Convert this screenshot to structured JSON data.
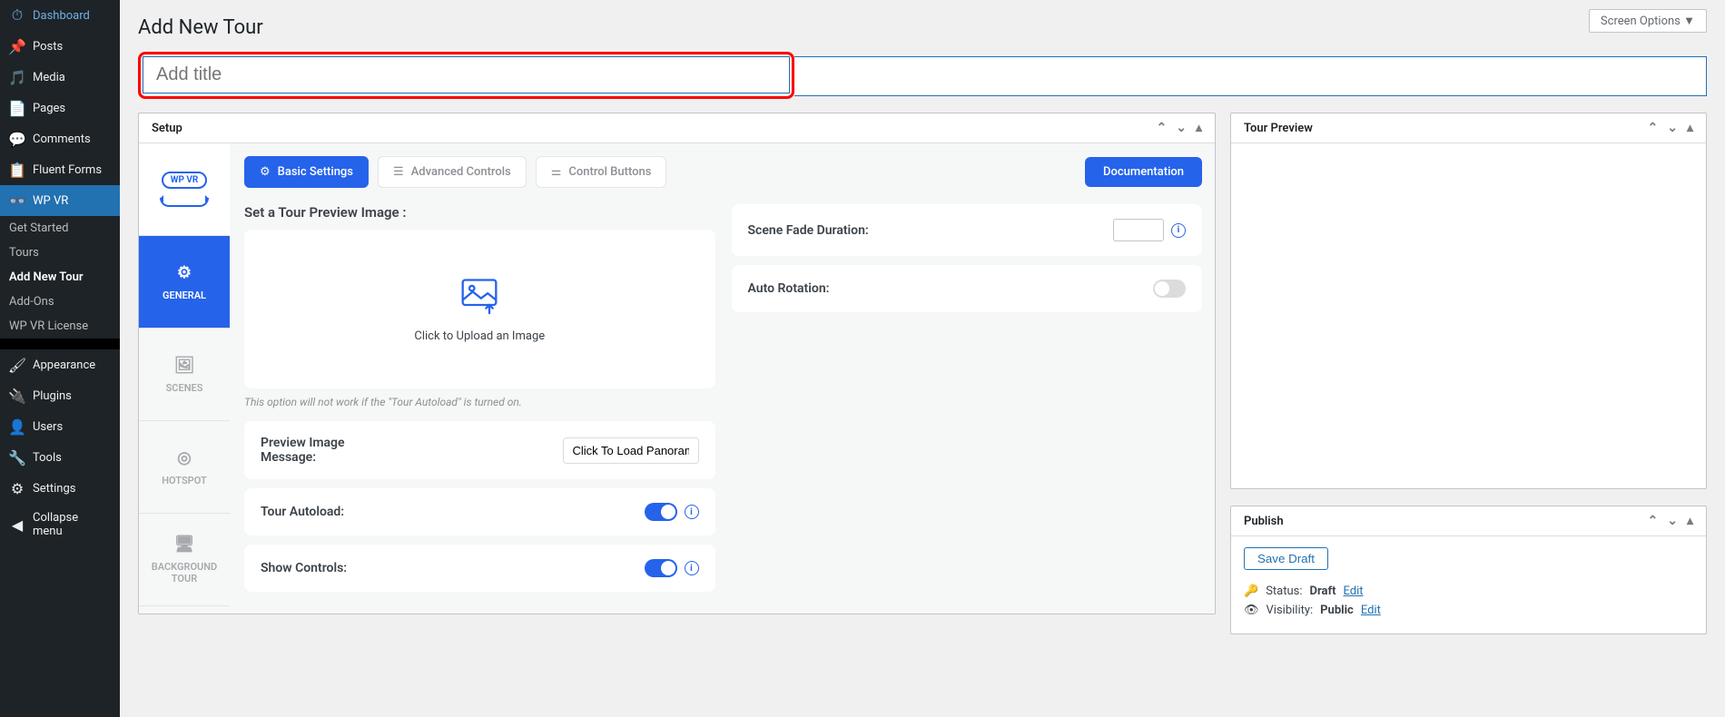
{
  "screen_options": "Screen Options",
  "page_title": "Add New Tour",
  "title_placeholder": "Add title",
  "sidebar": {
    "items": [
      {
        "label": "Dashboard",
        "icon": "dashboard"
      },
      {
        "label": "Posts",
        "icon": "pin"
      },
      {
        "label": "Media",
        "icon": "media"
      },
      {
        "label": "Pages",
        "icon": "pages"
      },
      {
        "label": "Comments",
        "icon": "comment"
      },
      {
        "label": "Fluent Forms",
        "icon": "forms"
      },
      {
        "label": "WP VR",
        "icon": "vr"
      },
      {
        "label": "Appearance",
        "icon": "appearance"
      },
      {
        "label": "Plugins",
        "icon": "plugins"
      },
      {
        "label": "Users",
        "icon": "users"
      },
      {
        "label": "Tools",
        "icon": "tools"
      },
      {
        "label": "Settings",
        "icon": "settings"
      },
      {
        "label": "Collapse menu",
        "icon": "collapse"
      }
    ],
    "sub": [
      {
        "label": "Get Started"
      },
      {
        "label": "Tours"
      },
      {
        "label": "Add New Tour"
      },
      {
        "label": "Add-Ons"
      },
      {
        "label": "WP VR License"
      }
    ]
  },
  "setup": {
    "title": "Setup",
    "logo": "WP VR",
    "tabs": {
      "general": "GENERAL",
      "scenes": "SCENES",
      "hotspot": "HOTSPOT",
      "background": "BACKGROUND TOUR"
    },
    "top_tabs": {
      "basic": "Basic Settings",
      "advanced": "Advanced Controls",
      "control": "Control Buttons"
    },
    "doc_btn": "Documentation",
    "preview_label": "Set a Tour Preview Image :",
    "upload_text": "Click to Upload an Image",
    "hint": "This option will not work if the \"Tour Autoload\" is turned on.",
    "preview_msg_label": "Preview Image Message:",
    "preview_msg_value": "Click To Load Panoram",
    "autoload_label": "Tour Autoload:",
    "show_controls_label": "Show Controls:",
    "fade_label": "Scene Fade Duration:",
    "rotation_label": "Auto Rotation:"
  },
  "tour_preview": {
    "title": "Tour Preview"
  },
  "publish": {
    "title": "Publish",
    "save_draft": "Save Draft",
    "status_label": "Status:",
    "status_value": "Draft",
    "status_edit": "Edit",
    "visibility_label": "Visibility:",
    "visibility_value": "Public",
    "visibility_edit": "Edit"
  }
}
